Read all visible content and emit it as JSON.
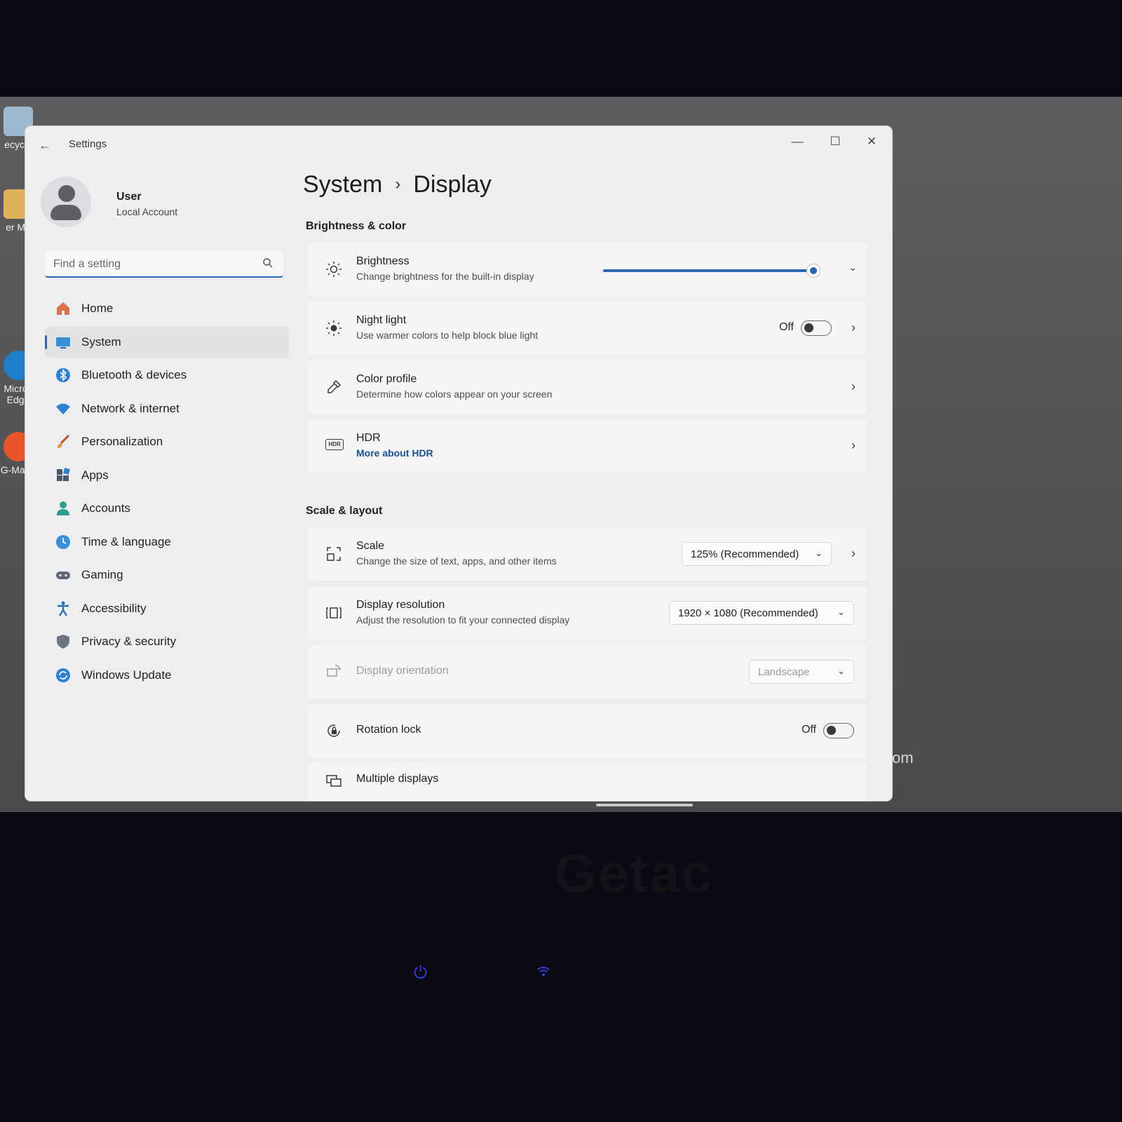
{
  "desktop": {
    "icons": [
      {
        "label": "ecycle"
      },
      {
        "label": "er Ma"
      },
      {
        "label": "Micros Edge"
      },
      {
        "label": "G-Mana"
      }
    ],
    "logo_fragment": "om",
    "bezel_brand": "Getac"
  },
  "window": {
    "title": "Settings",
    "controls": {
      "minimize": "—",
      "maximize": "☐",
      "close": "✕"
    }
  },
  "profile": {
    "name": "User",
    "account_type": "Local Account"
  },
  "search": {
    "placeholder": "Find a setting"
  },
  "nav": {
    "items": [
      {
        "label": "Home"
      },
      {
        "label": "System"
      },
      {
        "label": "Bluetooth & devices"
      },
      {
        "label": "Network & internet"
      },
      {
        "label": "Personalization"
      },
      {
        "label": "Apps"
      },
      {
        "label": "Accounts"
      },
      {
        "label": "Time & language"
      },
      {
        "label": "Gaming"
      },
      {
        "label": "Accessibility"
      },
      {
        "label": "Privacy & security"
      },
      {
        "label": "Windows Update"
      }
    ],
    "active": "System"
  },
  "breadcrumb": {
    "parent": "System",
    "current": "Display"
  },
  "brightness_color": {
    "section_title": "Brightness & color",
    "brightness": {
      "title": "Brightness",
      "subtitle": "Change brightness for the built-in display",
      "level": 1.0
    },
    "night_light": {
      "title": "Night light",
      "subtitle": "Use warmer colors to help block blue light",
      "state": "Off"
    },
    "color_profile": {
      "title": "Color profile",
      "subtitle": "Determine how colors appear on your screen"
    },
    "hdr": {
      "title": "HDR",
      "link": "More about HDR",
      "icon_text": "HDR"
    }
  },
  "scale_layout": {
    "section_title": "Scale & layout",
    "scale": {
      "title": "Scale",
      "subtitle": "Change the size of text, apps, and other items",
      "value": "125% (Recommended)"
    },
    "resolution": {
      "title": "Display resolution",
      "subtitle": "Adjust the resolution to fit your connected display",
      "value": "1920 × 1080 (Recommended)"
    },
    "orientation": {
      "title": "Display orientation",
      "value": "Landscape"
    },
    "rotation_lock": {
      "title": "Rotation lock",
      "state": "Off"
    },
    "multiple_displays": {
      "title": "Multiple displays"
    }
  },
  "colors": {
    "accent": "#2b67b4",
    "link": "#1a4f8f"
  }
}
